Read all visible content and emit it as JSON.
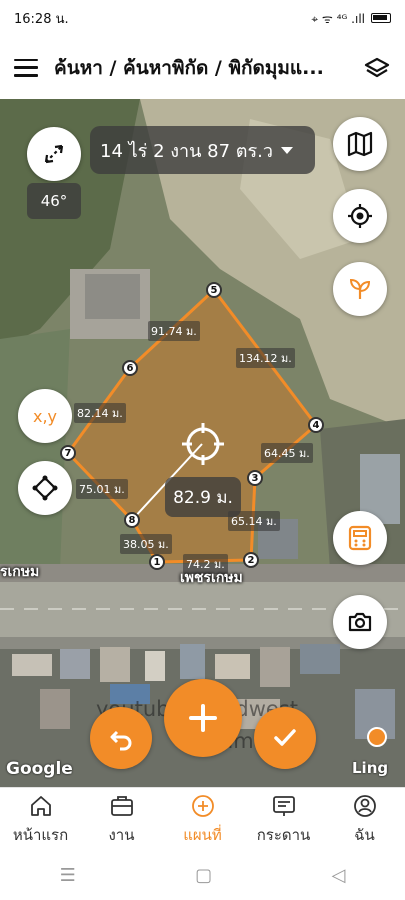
{
  "status_bar": {
    "time": "16:28 น.",
    "icons": "⌖ ᯤ ⁴ᴳ .ıll"
  },
  "header": {
    "title": "ค้นหา / ค้นหาพิกัด / พิกัดมุมแ..."
  },
  "map": {
    "area_text": "14 ไร่ 2 งาน 87 ตร.ว",
    "bearing_text": "46°",
    "xy_button_label": "x,y",
    "distance_text": "82.9 ม.",
    "segment_labels": [
      "91.74 ม.",
      "134.12 ม.",
      "82.14 ม.",
      "75.01 ม.",
      "64.45 ม.",
      "65.14 ม.",
      "38.05 ม.",
      "74.2 ม."
    ],
    "vertex_labels": [
      "1",
      "2",
      "3",
      "4",
      "5",
      "6",
      "7",
      "8"
    ],
    "road_labels": [
      "รเกษม",
      "เพชรเกษม"
    ],
    "attribution_left": "Google",
    "attribution_right": "Ling",
    "watermark_line1": "youtube@landwest",
    "watermark_line2": "mr tum"
  },
  "bottom_nav": {
    "items": [
      {
        "label": "หน้าแรก",
        "icon": "home-icon"
      },
      {
        "label": "งาน",
        "icon": "briefcase-icon"
      },
      {
        "label": "แผนที่",
        "icon": "plus-circle-icon"
      },
      {
        "label": "กระดาน",
        "icon": "board-icon"
      },
      {
        "label": "ฉัน",
        "icon": "user-icon"
      }
    ]
  },
  "system_nav": {
    "menu": "☰",
    "home": "▢",
    "back": "◁"
  },
  "colors": {
    "accent": "#f28c28",
    "polygon_fill": "#c47a2a"
  }
}
